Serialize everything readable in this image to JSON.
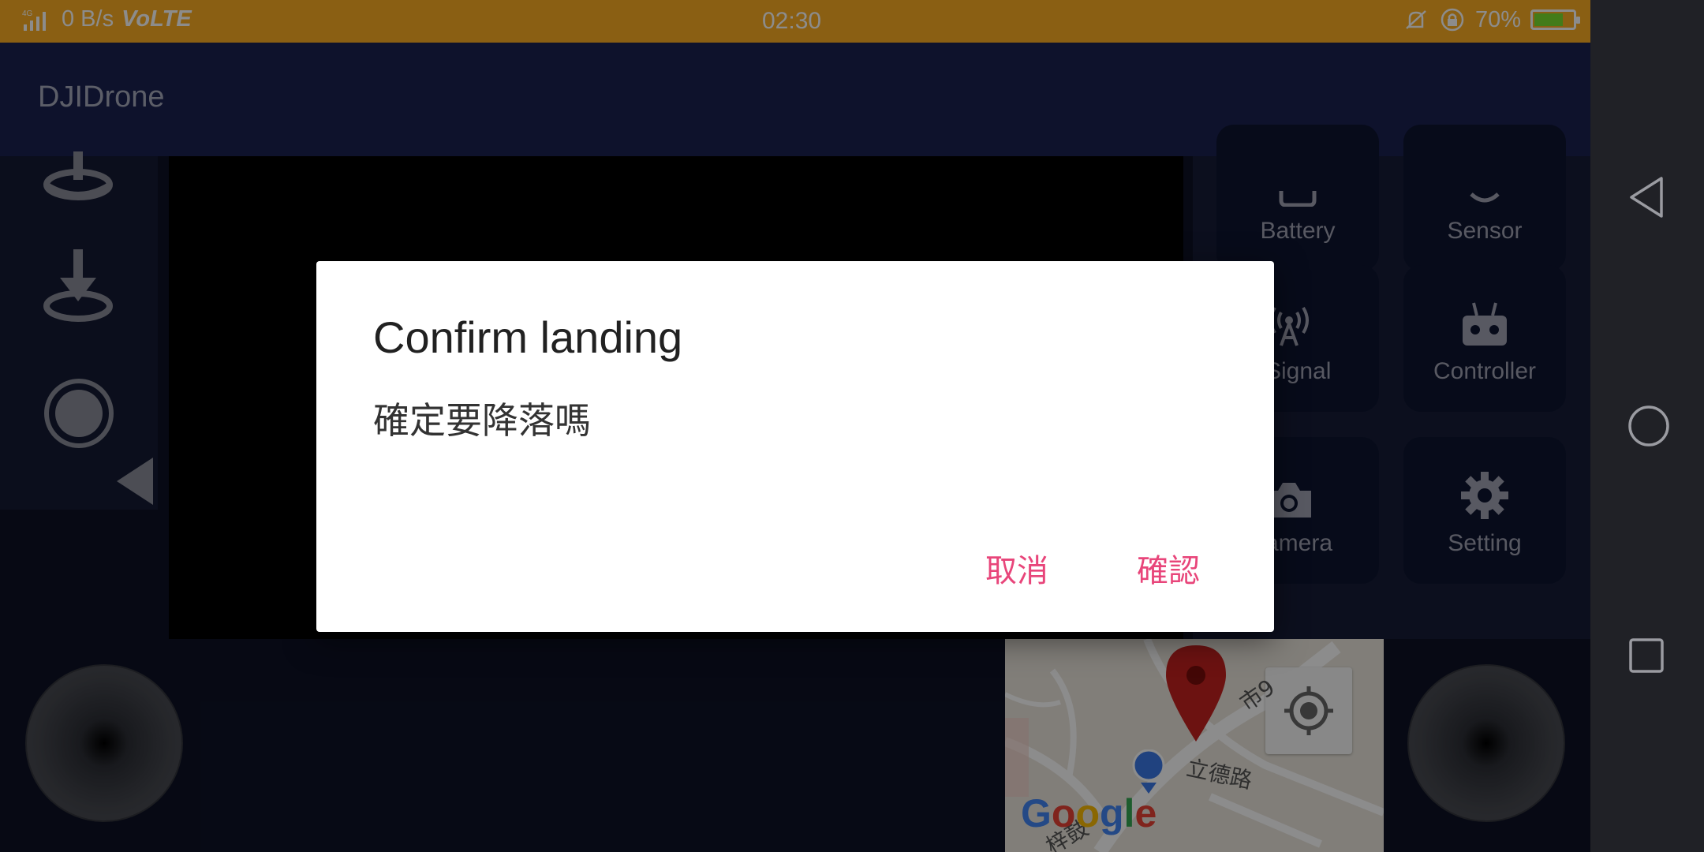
{
  "status_bar": {
    "network": "4G",
    "speed": "0 B/s",
    "volte": "VoLTE",
    "time": "02:30",
    "battery": "70%",
    "battery_level": 0.7
  },
  "app": {
    "title": "DJIDrone"
  },
  "left_controls": [
    {
      "name": "takeoff-icon"
    },
    {
      "name": "landing-icon"
    },
    {
      "name": "record-icon"
    },
    {
      "name": "collapse-arrow-icon"
    }
  ],
  "tiles": [
    {
      "label": "Battery",
      "icon": "battery-icon"
    },
    {
      "label": "Sensor",
      "icon": "sensor-icon"
    },
    {
      "label": "Signal",
      "icon": "signal-icon"
    },
    {
      "label": "Controller",
      "icon": "controller-icon"
    },
    {
      "label": "amera",
      "icon": "camera-icon"
    },
    {
      "label": "Setting",
      "icon": "gear-icon"
    }
  ],
  "map": {
    "street_1": "立德路",
    "street_2": "市9",
    "street_3": "梓鼓",
    "logo": "Google"
  },
  "dialog": {
    "title": "Confirm landing",
    "message": "確定要降落嗎",
    "cancel": "取消",
    "confirm": "確認"
  },
  "colors": {
    "status_bar": "#fbae23",
    "app_bar": "#1b2150",
    "accent": "#e8457a"
  }
}
